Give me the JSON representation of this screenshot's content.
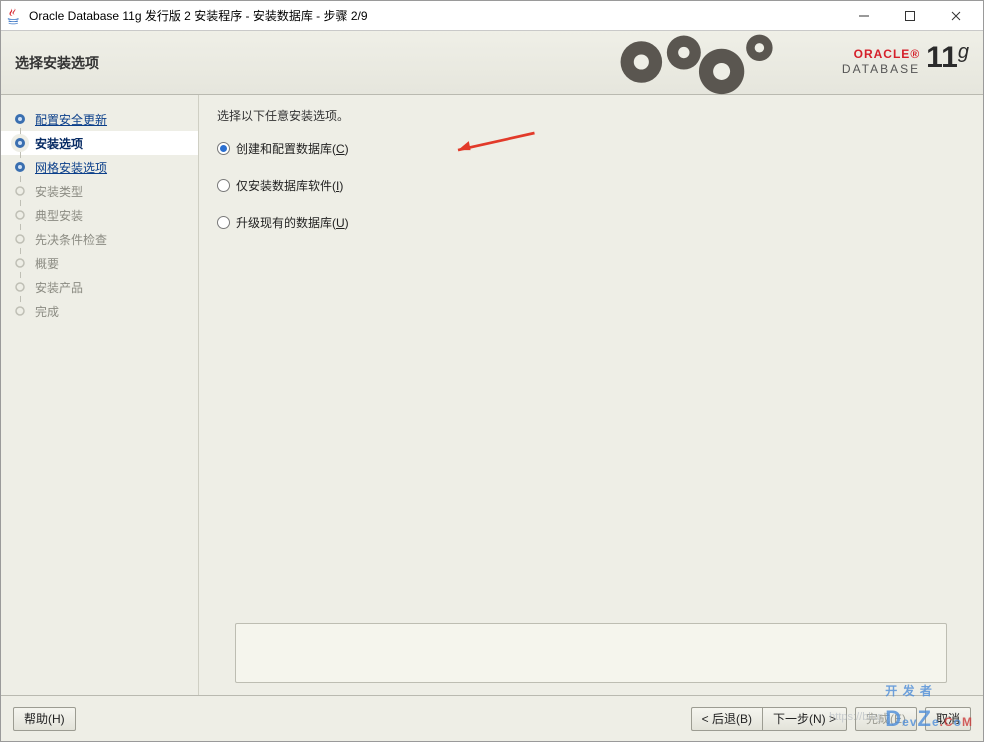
{
  "window": {
    "title": "Oracle Database 11g 发行版 2 安装程序 - 安装数据库 - 步骤 2/9"
  },
  "header": {
    "title": "选择安装选项",
    "brand_top": "ORACLE",
    "brand_bottom": "DATABASE",
    "brand_ver_num": "11",
    "brand_ver_suffix": "g"
  },
  "sidebar": {
    "steps": [
      {
        "label": "配置安全更新",
        "state": "completed"
      },
      {
        "label": "安装选项",
        "state": "active"
      },
      {
        "label": "网格安装选项",
        "state": "clickable"
      },
      {
        "label": "安装类型",
        "state": "disabled"
      },
      {
        "label": "典型安装",
        "state": "disabled"
      },
      {
        "label": "先决条件检查",
        "state": "disabled"
      },
      {
        "label": "概要",
        "state": "disabled"
      },
      {
        "label": "安装产品",
        "state": "disabled"
      },
      {
        "label": "完成",
        "state": "disabled"
      }
    ]
  },
  "content": {
    "instruction": "选择以下任意安装选项。",
    "options": [
      {
        "label_pre": "创建和配置数据库(",
        "mnemonic": "C",
        "label_post": ")",
        "selected": true
      },
      {
        "label_pre": "仅安装数据库软件(",
        "mnemonic": "I",
        "label_post": ")",
        "selected": false
      },
      {
        "label_pre": "升级现有的数据库(",
        "mnemonic": "U",
        "label_post": ")",
        "selected": false
      }
    ]
  },
  "footer": {
    "help": "帮助(H)",
    "back": "< 后退(B)",
    "next": "下一步(N) >",
    "finish": "完成(E)",
    "cancel": "取消"
  },
  "watermark": {
    "text_cn": "开 发 者",
    "text_en": "DevZe.CoM",
    "url": "https://blog"
  }
}
